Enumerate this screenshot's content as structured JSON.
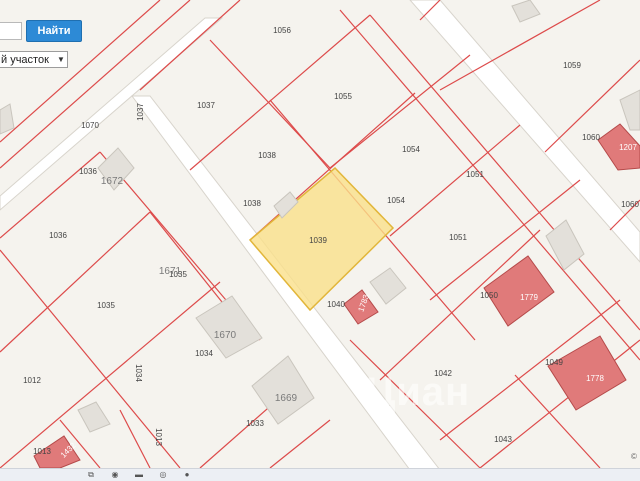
{
  "search": {
    "button_label": "Найти",
    "input_value": ""
  },
  "select": {
    "value": "й участок"
  },
  "watermark": "Циан",
  "copyright": "©",
  "colors": {
    "highlight": "#fae08a",
    "parcel_border": "#dd4b4b",
    "building_red": "#e07a7a",
    "search_button": "#2d8ad6"
  },
  "parcels": [
    {
      "label": "1056"
    },
    {
      "label": "1059"
    },
    {
      "label": "1037"
    },
    {
      "label": "1037"
    },
    {
      "label": "1055"
    },
    {
      "label": "1070"
    },
    {
      "label": "1060"
    },
    {
      "label": "1038"
    },
    {
      "label": "1054"
    },
    {
      "label": "1036"
    },
    {
      "label": "1051"
    },
    {
      "label": "1038"
    },
    {
      "label": "1054"
    },
    {
      "label": "1060"
    },
    {
      "label": "1039"
    },
    {
      "label": "1036"
    },
    {
      "label": "1051"
    },
    {
      "label": "1035"
    },
    {
      "label": "1050"
    },
    {
      "label": "1040"
    },
    {
      "label": "1035"
    },
    {
      "label": "1034"
    },
    {
      "label": "1049"
    },
    {
      "label": "1012"
    },
    {
      "label": "1034"
    },
    {
      "label": "1042"
    },
    {
      "label": "1033"
    },
    {
      "label": "1013"
    },
    {
      "label": "1043"
    },
    {
      "label": "1013"
    }
  ],
  "buildings": [
    {
      "label": "1672"
    },
    {
      "label": "1671"
    },
    {
      "label": "1670"
    },
    {
      "label": "1669"
    },
    {
      "label": "1779"
    },
    {
      "label": "1778"
    },
    {
      "label": "1207"
    },
    {
      "label": "1783"
    },
    {
      "label": "1432"
    }
  ],
  "taskbar": {
    "items": [
      {
        "name": "start",
        "glyph": ""
      },
      {
        "name": "task-view-icon",
        "glyph": "⧉"
      },
      {
        "name": "chrome-icon",
        "glyph": "◉"
      },
      {
        "name": "explorer-icon",
        "glyph": "▬"
      },
      {
        "name": "edge-icon",
        "glyph": "◎"
      },
      {
        "name": "app-icon",
        "glyph": "●"
      }
    ]
  }
}
